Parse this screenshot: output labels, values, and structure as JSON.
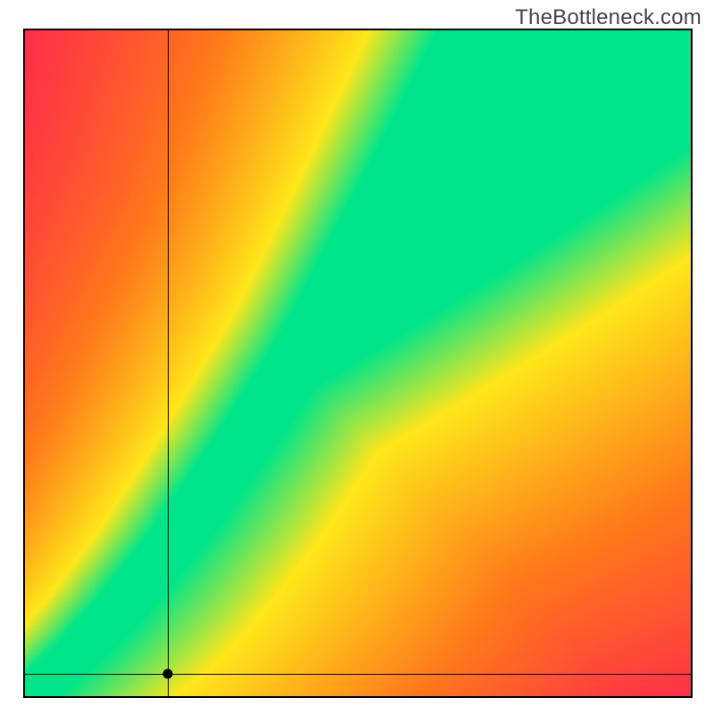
{
  "watermark": "TheBottleneck.com",
  "chart_data": {
    "type": "heatmap",
    "title": "",
    "xlabel": "",
    "ylabel": "",
    "xlim": [
      0,
      1
    ],
    "ylim": [
      0,
      1
    ],
    "grid": false,
    "legend": false,
    "colorscale_note": "red→orange→yellow→green→yellow; green ridge along a curve through origin",
    "colors": {
      "red": "#ff1a55",
      "orange": "#ff7a1a",
      "yellow": "#ffe71a",
      "green": "#00e58a"
    },
    "ridge_curve": {
      "description": "x as a function of y; slightly super-linear below ~0.25, then roughly linear",
      "points": [
        {
          "y": 0.0,
          "x": 0.0
        },
        {
          "y": 0.05,
          "x": 0.06
        },
        {
          "y": 0.1,
          "x": 0.11
        },
        {
          "y": 0.15,
          "x": 0.155
        },
        {
          "y": 0.2,
          "x": 0.195
        },
        {
          "y": 0.25,
          "x": 0.235
        },
        {
          "y": 0.3,
          "x": 0.27
        },
        {
          "y": 0.4,
          "x": 0.34
        },
        {
          "y": 0.5,
          "x": 0.405
        },
        {
          "y": 0.6,
          "x": 0.47
        },
        {
          "y": 0.7,
          "x": 0.535
        },
        {
          "y": 0.8,
          "x": 0.6
        },
        {
          "y": 0.9,
          "x": 0.665
        },
        {
          "y": 1.0,
          "x": 0.73
        }
      ]
    },
    "band_half_width": 0.035,
    "marker": {
      "x": 0.215,
      "y": 0.033
    },
    "crosshair": {
      "x": 0.215,
      "y": 0.033
    }
  }
}
